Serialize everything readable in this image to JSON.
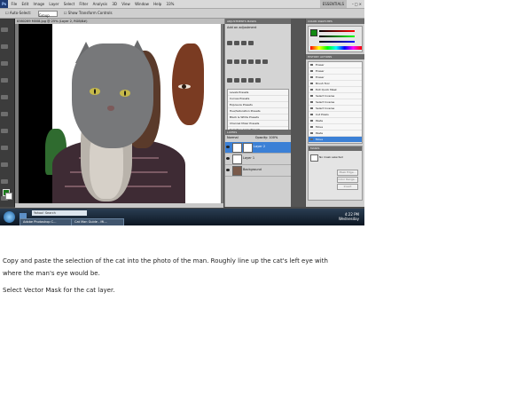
{
  "screenshot": {
    "app_menu": {
      "logo": "Ps",
      "items": [
        "File",
        "Edit",
        "Image",
        "Layer",
        "Select",
        "Filter",
        "Analysis",
        "3D",
        "View",
        "Window",
        "Help"
      ],
      "zoom": "33%",
      "workspace": "ESSENTIALS"
    },
    "options_bar": {
      "auto_select_label": "Auto-Select:",
      "auto_select_value": "Group",
      "transform_label": "Show Transform Controls"
    },
    "document_tab": "8380269 M008.jpg @ 25% (Layer 2, RGB/8#)",
    "panels": {
      "adjustments_tab": "ADJUSTMENTS",
      "masks_tab": "MASKS",
      "adjustments_title": "Add an adjustment",
      "presets": [
        "Levels Presets",
        "Curves Presets",
        "Exposure Presets",
        "Hue/Saturation Presets",
        "Black & White Presets",
        "Channel Mixer Presets",
        "Selective Color Presets"
      ],
      "layers_tab": "LAYERS",
      "blend_mode": "Normal",
      "opacity_label": "Opacity:",
      "opacity_value": "100%",
      "layers": [
        {
          "name": "Layer 2",
          "selected": true
        },
        {
          "name": "Layer 1",
          "selected": false
        },
        {
          "name": "Background",
          "selected": false
        }
      ],
      "color_tab": "COLOR",
      "swatches_tab": "SWATCHES",
      "history_tab": "HISTORY",
      "actions_tab": "ACTIONS",
      "history": [
        "Eraser",
        "Eraser",
        "Eraser",
        "Brush Tool",
        "Exit Quick Mask",
        "Select Inverse",
        "Select Inverse",
        "Select Inverse",
        "Cut Pixels",
        "Paste",
        "Move",
        "Paste",
        "Move"
      ],
      "masks_panel_title": "MASKS",
      "masks_status": "No mask selected",
      "mask_buttons": [
        "Mask Edge...",
        "Color Range...",
        "Invert"
      ]
    },
    "taskbar": {
      "search_placeholder": "Yahoo! Search",
      "tasks": [
        "Adobe Photoshop C...",
        "Cat Man Guide - Mi..."
      ],
      "time": "4:22 PM",
      "day": "Wednesday"
    }
  },
  "caption": {
    "line1": "Copy and paste the selection of the cat into the photo of the man. Roughly line up the cat's left eye with",
    "line2": "where the man's eye would be.",
    "line3": "Select Vector Mask for the cat layer."
  },
  "colors": {
    "layer_selected": "#3b80d6",
    "foreground_swatch": "#1a7a1a"
  }
}
